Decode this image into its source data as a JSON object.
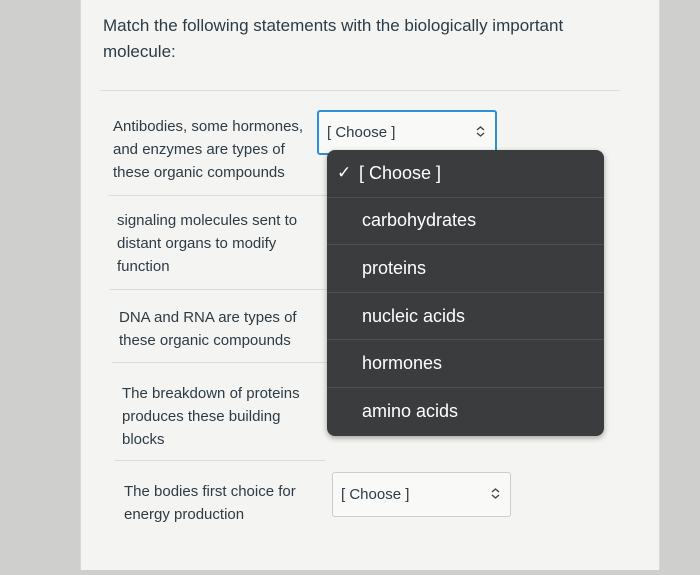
{
  "question": "Match the following statements with the biologically important molecule:",
  "statements": [
    "Antibodies, some hormones, and enzymes are types of these organic compounds",
    "signaling molecules sent to distant organs to modify function",
    "DNA and RNA are types of these organic compounds",
    "The breakdown of proteins produces these building blocks",
    "The bodies first choice for energy production"
  ],
  "selects": [
    {
      "value": "[ Choose ]",
      "arrow_icon": "updown-chevron-icon"
    },
    {
      "value": "[ Choose ]",
      "arrow_icon": "updown-chevron-icon"
    }
  ],
  "dropdown": {
    "options": [
      {
        "label": "[ Choose ]",
        "selected": true,
        "check": "✓"
      },
      {
        "label": "carbohydrates",
        "selected": false
      },
      {
        "label": "proteins",
        "selected": false
      },
      {
        "label": "nucleic acids",
        "selected": false
      },
      {
        "label": "hormones",
        "selected": false
      },
      {
        "label": "amino acids",
        "selected": false
      }
    ]
  },
  "colors": {
    "accent": "#2d8fd5",
    "dropdown_bg": "#3a3c3e"
  }
}
